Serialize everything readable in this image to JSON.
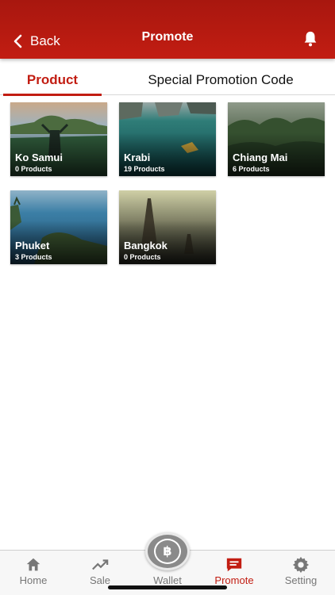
{
  "header": {
    "back_label": "Back",
    "title": "Promote",
    "back_icon": "chevron-left-icon",
    "notification_icon": "bell-icon"
  },
  "tabs": [
    {
      "label": "Product",
      "active": true
    },
    {
      "label": "Special Promotion Code",
      "active": false
    }
  ],
  "destinations": [
    {
      "name": "Ko Samui",
      "count": "0 Products"
    },
    {
      "name": "Krabi",
      "count": "19 Products"
    },
    {
      "name": "Chiang Mai",
      "count": "6 Products"
    },
    {
      "name": "Phuket",
      "count": "3 Products"
    },
    {
      "name": "Bangkok",
      "count": "0 Products"
    }
  ],
  "tabbar": {
    "items": [
      {
        "label": "Home",
        "icon": "home-icon"
      },
      {
        "label": "Sale",
        "icon": "trending-up-icon"
      },
      {
        "label": "Wallet",
        "icon": "baht-coin-icon",
        "glyph": "฿"
      },
      {
        "label": "Promote",
        "icon": "chat-icon",
        "active": true
      },
      {
        "label": "Setting",
        "icon": "gear-icon"
      }
    ]
  },
  "colors": {
    "brand": "#c21d12",
    "inactive": "#777777"
  }
}
